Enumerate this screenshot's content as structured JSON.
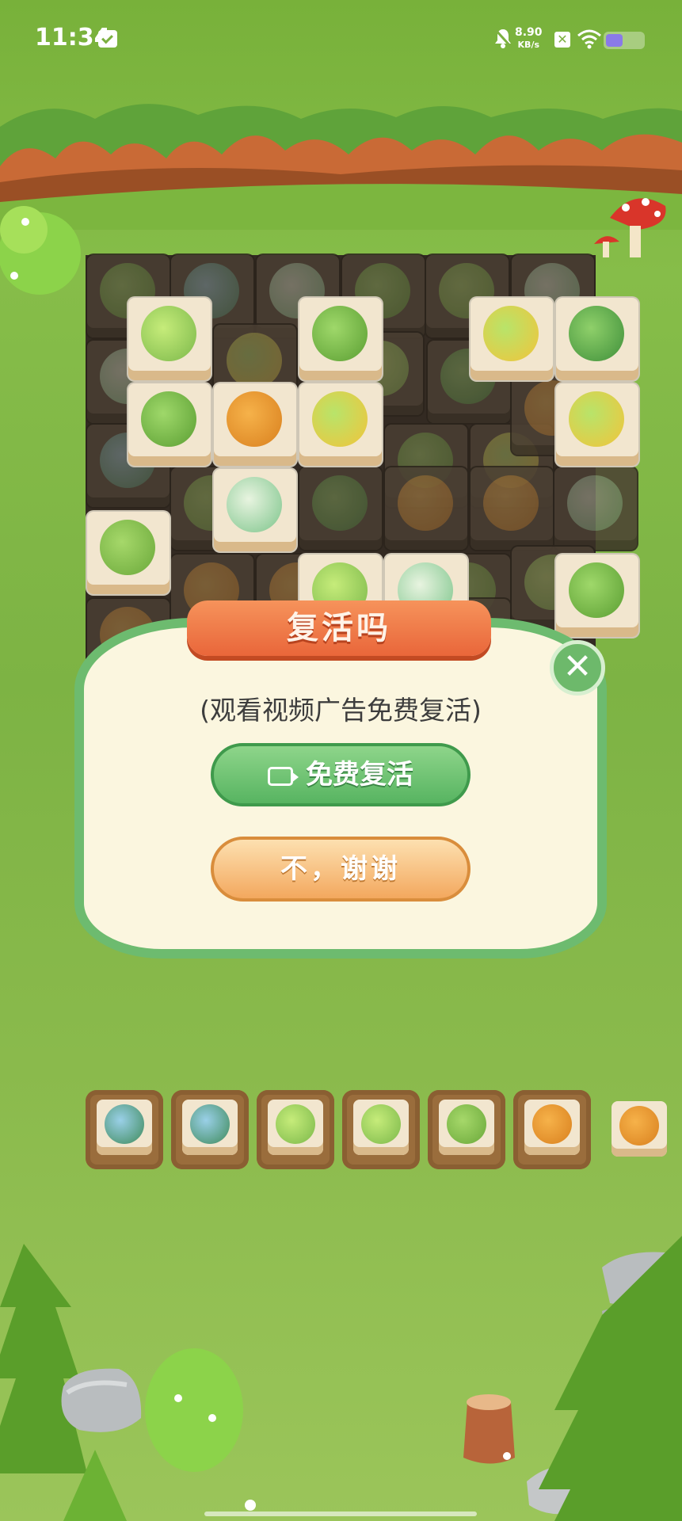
{
  "status_bar": {
    "time": "11:34",
    "net_speed_value": "8.90",
    "net_speed_unit": "KB/s",
    "battery_level": 0.45,
    "xbox_glyph": "✕"
  },
  "popup": {
    "title": "复活吗",
    "subtitle": "(观看视频广告免费复活)",
    "revive_label": "免费复活",
    "decline_label": "不，谢谢",
    "close_glyph": "✕"
  },
  "board": {
    "creatures": [
      "green-frog-hat",
      "orange-blob",
      "yellow-duck-sprout",
      "cactus-frog",
      "green-cat",
      "turtle",
      "green-sprout-bud",
      "pink-crest-bird"
    ]
  },
  "tray": {
    "slots": [
      "turtle",
      "turtle",
      "green-sprout-bud",
      "green-sprout-bud",
      "green-cat",
      "orange-blob"
    ],
    "extra": "orange-blob"
  },
  "colors": {
    "accent_green": "#6dbb6f",
    "banner_orange": "#e9663a",
    "popup_bg": "#fbf6df"
  }
}
